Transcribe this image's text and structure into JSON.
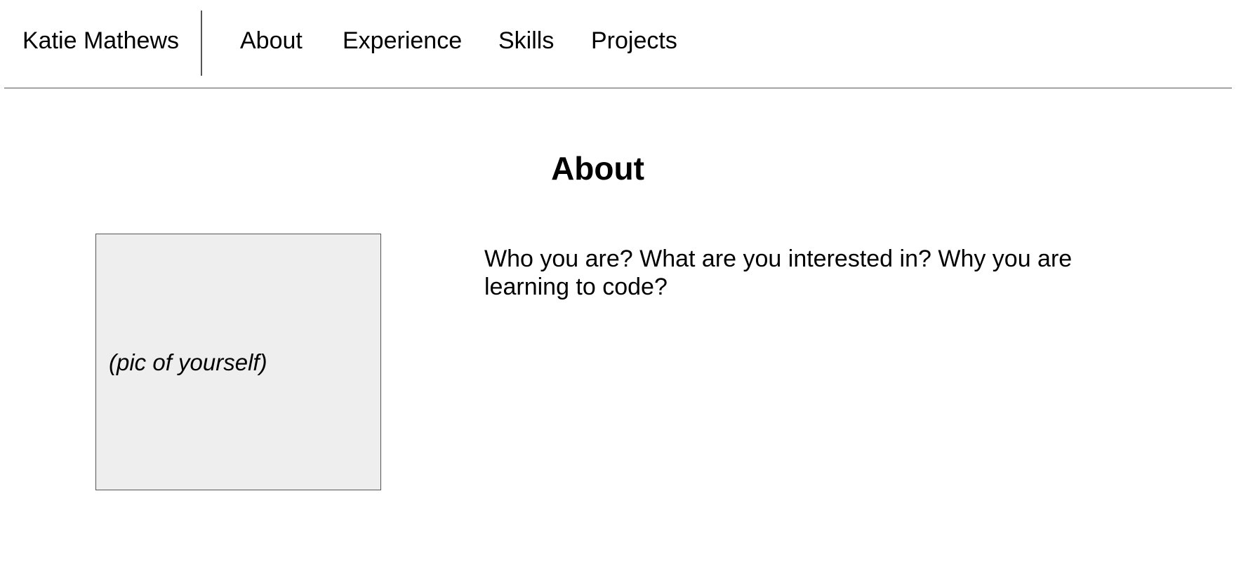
{
  "header": {
    "brand": "Katie Mathews",
    "nav": [
      {
        "label": "About"
      },
      {
        "label": "Experience"
      },
      {
        "label": "Skills"
      },
      {
        "label": "Projects"
      }
    ]
  },
  "about": {
    "title": "About",
    "photo_placeholder": "(pic of yourself)",
    "body": "Who you are? What are you interested in? Why you are learning to code?"
  }
}
